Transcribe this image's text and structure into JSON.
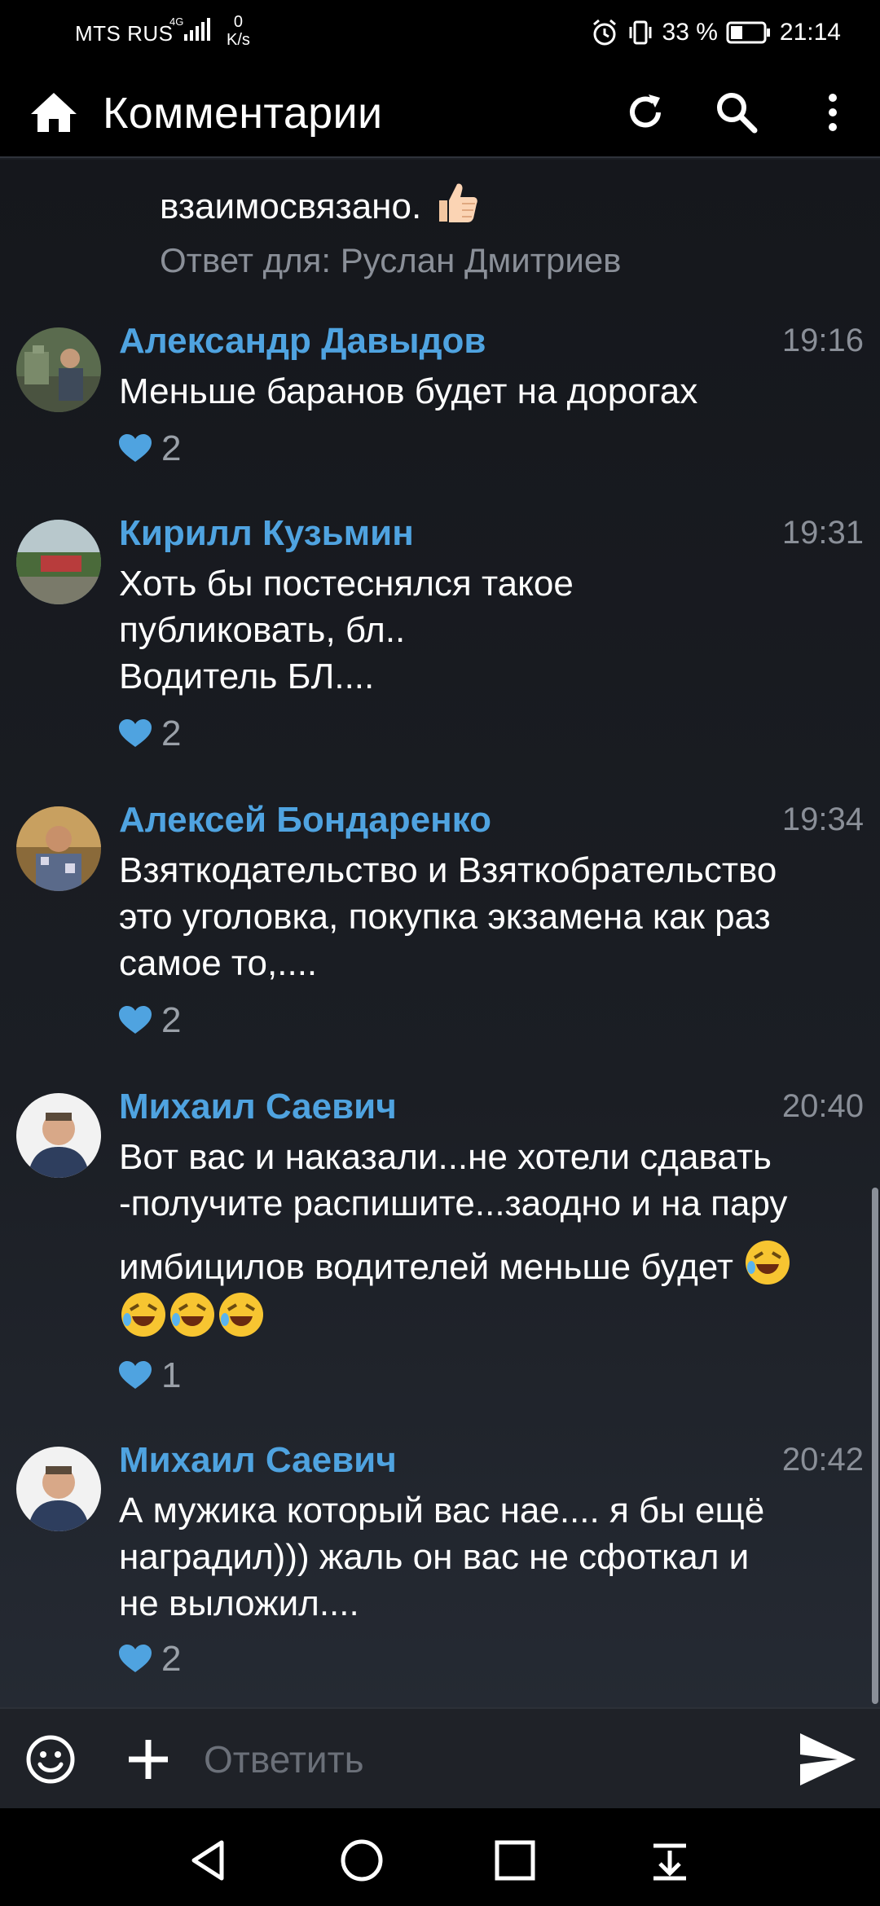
{
  "status_bar": {
    "carrier": "MTS RUS",
    "network": "4G",
    "speed_value": "0",
    "speed_unit": "K/s",
    "battery": "33 %",
    "time": "21:14"
  },
  "app_bar": {
    "title": "Комментарии",
    "icons": [
      "home-icon",
      "refresh-icon",
      "search-icon",
      "more-vert-icon"
    ]
  },
  "partial_comment": {
    "text": "взаимосвязано.",
    "reply_to": "Ответ для: Руслан Дмитриев"
  },
  "comments": [
    {
      "author": "Александр Давыдов",
      "time": "19:16",
      "lines": [
        "Меньше баранов будет на дорогах"
      ],
      "likes": "2"
    },
    {
      "author": "Кирилл Кузьмин",
      "time": "19:31",
      "lines": [
        "Хоть бы постеснялся такое",
        "публиковать, бл..",
        "Водитель БЛ...."
      ],
      "likes": "2"
    },
    {
      "author": "Алексей Бондаренко",
      "time": "19:34",
      "lines": [
        "Взяткодательство и Взяткобрательство",
        "это уголовка, покупка экзамена как раз",
        "самое то,...."
      ],
      "likes": "2"
    },
    {
      "author": "Михаил Саевич",
      "time": "20:40",
      "lines": [
        "Вот вас и наказали...не хотели сдавать",
        "-получите распишите...заодно и на пару",
        "имбицилов водителей меньше будет"
      ],
      "likes": "1"
    },
    {
      "author": "Михаил Саевич",
      "time": "20:42",
      "lines": [
        "А мужика который вас нае....  я бы ещё",
        "наградил))) жаль он вас не сфоткал и",
        "не выложил...."
      ],
      "likes": "2"
    }
  ],
  "reply_bar": {
    "placeholder": "Ответить"
  },
  "colors": {
    "accent": "#4fa3e0",
    "background": "#1b1e24",
    "secondary_text": "#8a8f98"
  }
}
